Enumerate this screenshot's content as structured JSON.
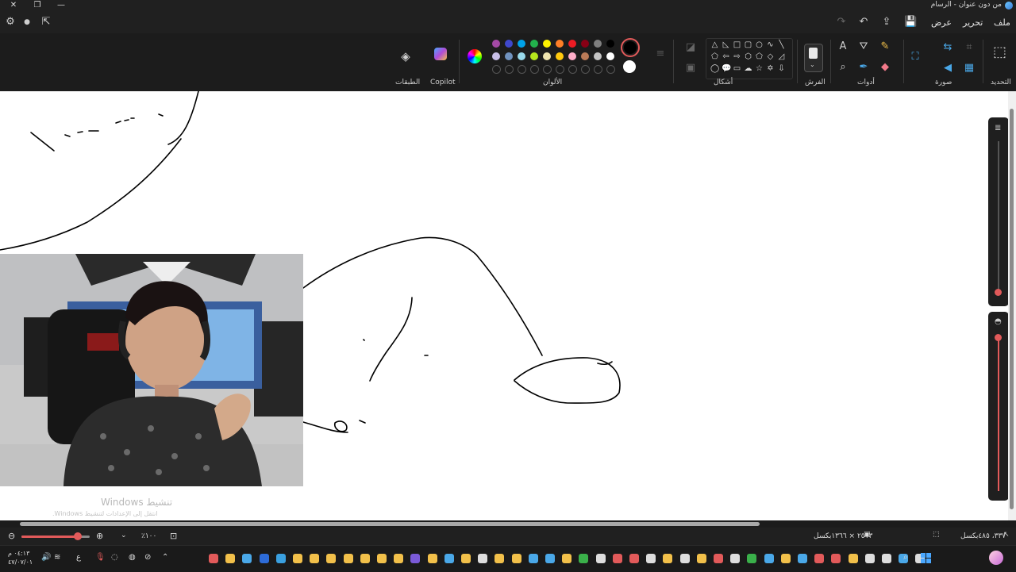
{
  "window": {
    "title": "من دون عنوان - الرسام",
    "controls": [
      "close-icon",
      "maximize-icon",
      "minimize-icon"
    ]
  },
  "menu": {
    "file": "ملف",
    "edit": "تحرير",
    "view": "عرض"
  },
  "ribbon": {
    "groups": {
      "selection": "التحديد",
      "image": "صورة",
      "tools": "أدوات",
      "brushes": "الفرش",
      "shapes": "أشكال",
      "colors": "الألوان",
      "copilot": "Copilot",
      "layers": "الطبقات"
    },
    "colors_row1": [
      "#000000",
      "#7f7f7f",
      "#880015",
      "#ed1c24",
      "#ff7f27",
      "#fff200",
      "#22b14c",
      "#00a2e8",
      "#3f48cc",
      "#a349a4"
    ],
    "colors_row2": [
      "#ffffff",
      "#c3c3c3",
      "#b97a57",
      "#ffaec9",
      "#ffc90e",
      "#efe4b0",
      "#b5e61d",
      "#99d9ea",
      "#7092be",
      "#c8bfe7"
    ],
    "primary_color": "#000000",
    "secondary_color": "#ffffff"
  },
  "canvas": {
    "watermark_title": "تنشيط Windows",
    "watermark_sub": "انتقل إلى الإعدادات لتنشيط Windows."
  },
  "status": {
    "cursor_pos": "٣٣٧، ٤٨٥بكسل",
    "canvas_size": "٢٥١٣ × ١٣٦٦بكسل",
    "zoom": "١٠٠٪"
  },
  "taskbar": {
    "time": "٠٤:١٣ م",
    "date": "٤٧/٠٧/٠١",
    "lang": "ع"
  }
}
